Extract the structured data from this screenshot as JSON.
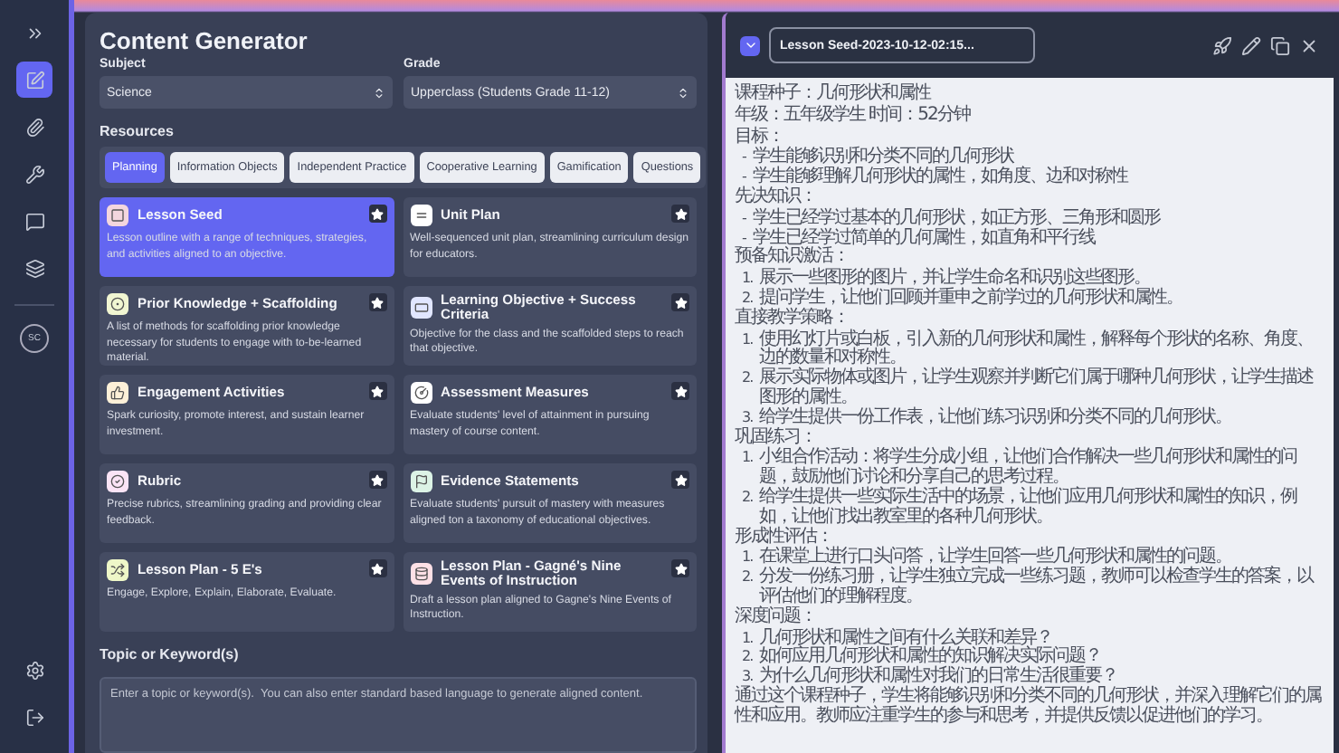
{
  "nav": [
    {
      "kind": "expand",
      "selected": false
    },
    {
      "kind": "edit",
      "selected": true
    },
    {
      "kind": "attach",
      "selected": false
    },
    {
      "kind": "tools",
      "selected": false
    },
    {
      "kind": "chat",
      "selected": false
    },
    {
      "kind": "layers",
      "selected": false
    }
  ],
  "user": {
    "initials": "SC"
  },
  "nav_bottom": [
    {
      "kind": "settings"
    },
    {
      "kind": "logout"
    }
  ],
  "generator": {
    "title": "Content Generator",
    "fields": [
      {
        "label": "Subject",
        "value": "Science"
      },
      {
        "label": "Grade",
        "value": "Upperclass (Students Grade 11-12)"
      }
    ],
    "resources_label": "Resources",
    "tabs": [
      {
        "label": "Planning",
        "selected": true
      },
      {
        "label": "Information Objects",
        "selected": false
      },
      {
        "label": "Independent Practice",
        "selected": false
      },
      {
        "label": "Cooperative Learning",
        "selected": false
      },
      {
        "label": "Gamification",
        "selected": false
      },
      {
        "label": "Questions",
        "selected": false
      }
    ],
    "cards": [
      {
        "kind": "seed",
        "color": "#f3d6de",
        "title": "Lesson Seed",
        "description": "Lesson outline with a range of techniques, strategies, and activities aligned to an objective.",
        "selected": true
      },
      {
        "kind": "list",
        "color": "#ffffff",
        "title": "Unit Plan",
        "description": "Well-sequenced unit plan, streamlining curriculum design for educators.",
        "selected": false
      },
      {
        "kind": "knowledge",
        "color": "#f1f6d2",
        "title": "Prior Knowledge + Scaffolding",
        "description": "A list of methods for scaffolding prior knowledge necessary for students to engage with to-be-learned material.",
        "selected": false
      },
      {
        "kind": "objective",
        "color": "#e1e6ff",
        "title": "Learning Objective + Success Criteria",
        "description": "Objective for the class and the scaffolded steps to reach that objective.",
        "selected": false
      },
      {
        "kind": "thumb",
        "color": "#fdf0d8",
        "title": "Engagement Activities",
        "description": "Spark curiosity, promote interest, and sustain learner investment.",
        "selected": false
      },
      {
        "kind": "measure",
        "color": "#ffffff",
        "title": "Assessment Measures",
        "description": "Evaluate students' level of attainment in pursuing mastery of course content.",
        "selected": false
      },
      {
        "kind": "rubric",
        "color": "#fbe4f6",
        "title": "Rubric",
        "description": "Precise rubrics, streamlining grading and providing clear feedback.",
        "selected": false
      },
      {
        "kind": "flag",
        "color": "#dcf3e6",
        "title": "Evidence Statements",
        "description": "Evaluate students' pursuit of mastery with measures aligned ton a taxonomy of educational objectives.",
        "selected": false
      },
      {
        "kind": "five",
        "color": "#eef7c8",
        "title": "Lesson Plan - 5 E's",
        "description": "Engage, Explore, Explain, Elaborate, Evaluate.",
        "selected": false
      },
      {
        "kind": "nine",
        "color": "#fde0e6",
        "title": "Lesson Plan - Gagné's Nine Events of Instruction",
        "description": "Draft a lesson plan aligned to Gagne's Nine Events of Instruction.",
        "selected": false
      }
    ],
    "topic": {
      "label": "Topic or Keyword(s)",
      "placeholder": "Enter a topic or keyword(s).  You can also enter standard based language to generate aligned content."
    }
  },
  "output": {
    "title": "Lesson Seed-2023-10-12-02:15...",
    "blocks": [
      {
        "kind": "para",
        "text": "课程种子：几何形状和属性"
      },
      {
        "kind": "para",
        "text": "年级：五年级学生 时间：52分钟"
      },
      {
        "kind": "para",
        "text": "目标："
      },
      {
        "kind": "list",
        "items": [
          {
            "marker": "-",
            "text": "学生能够识别和分类不同的几何形状"
          },
          {
            "marker": "-",
            "text": "学生能够理解几何形状的属性，如角度、边和对称性"
          }
        ]
      },
      {
        "kind": "para",
        "text": "先决知识："
      },
      {
        "kind": "list",
        "items": [
          {
            "marker": "-",
            "text": "学生已经学过基本的几何形状，如正方形、三角形和圆形"
          },
          {
            "marker": "-",
            "text": "学生已经学过简单的几何属性，如直角和平行线"
          }
        ]
      },
      {
        "kind": "para",
        "text": "预备知识激活："
      },
      {
        "kind": "list",
        "items": [
          {
            "marker": "1.",
            "text": "展示一些图形的图片，并让学生命名和识别这些图形。"
          },
          {
            "marker": "2.",
            "text": "提问学生，让他们回顾并重申之前学过的几何形状和属性。"
          }
        ]
      },
      {
        "kind": "para",
        "text": "直接教学策略："
      },
      {
        "kind": "list",
        "items": [
          {
            "marker": "1.",
            "text": "使用幻灯片或白板，引入新的几何形状和属性，解释每个形状的名称、角度、边的数量和对称性。"
          },
          {
            "marker": "2.",
            "text": "展示实际物体或图片，让学生观察并判断它们属于哪种几何形状，让学生描述图形的属性。"
          },
          {
            "marker": "3.",
            "text": "给学生提供一份工作表，让他们练习识别和分类不同的几何形状。"
          }
        ]
      },
      {
        "kind": "para",
        "text": "巩固练习："
      },
      {
        "kind": "list",
        "items": [
          {
            "marker": "1.",
            "text": "小组合作活动：将学生分成小组，让他们合作解决一些几何形状和属性的问题，鼓励他们讨论和分享自己的思考过程。"
          },
          {
            "marker": "2.",
            "text": "给学生提供一些实际生活中的场景，让他们应用几何形状和属性的知识，例如，让他们找出教室里的各种几何形状。"
          }
        ]
      },
      {
        "kind": "para",
        "text": "形成性评估："
      },
      {
        "kind": "list",
        "items": [
          {
            "marker": "1.",
            "text": "在课堂上进行口头问答，让学生回答一些几何形状和属性的问题。"
          },
          {
            "marker": "2.",
            "text": "分发一份练习册，让学生独立完成一些练习题，教师可以检查学生的答案，以评估他们的理解程度。"
          }
        ]
      },
      {
        "kind": "para",
        "text": "深度问题："
      },
      {
        "kind": "list",
        "items": [
          {
            "marker": "1.",
            "text": "几何形状和属性之间有什么关联和差异？"
          },
          {
            "marker": "2.",
            "text": "如何应用几何形状和属性的知识解决实际问题？"
          },
          {
            "marker": "3.",
            "text": "为什么几何形状和属性对我们的日常生活很重要？"
          }
        ]
      },
      {
        "kind": "para",
        "text": "通过这个课程种子，学生将能够识别和分类不同的几何形状，并深入理解它们的属性和应用。教师应注重学生的参与和思考，并提供反馈以促进他们的学习。"
      }
    ]
  }
}
